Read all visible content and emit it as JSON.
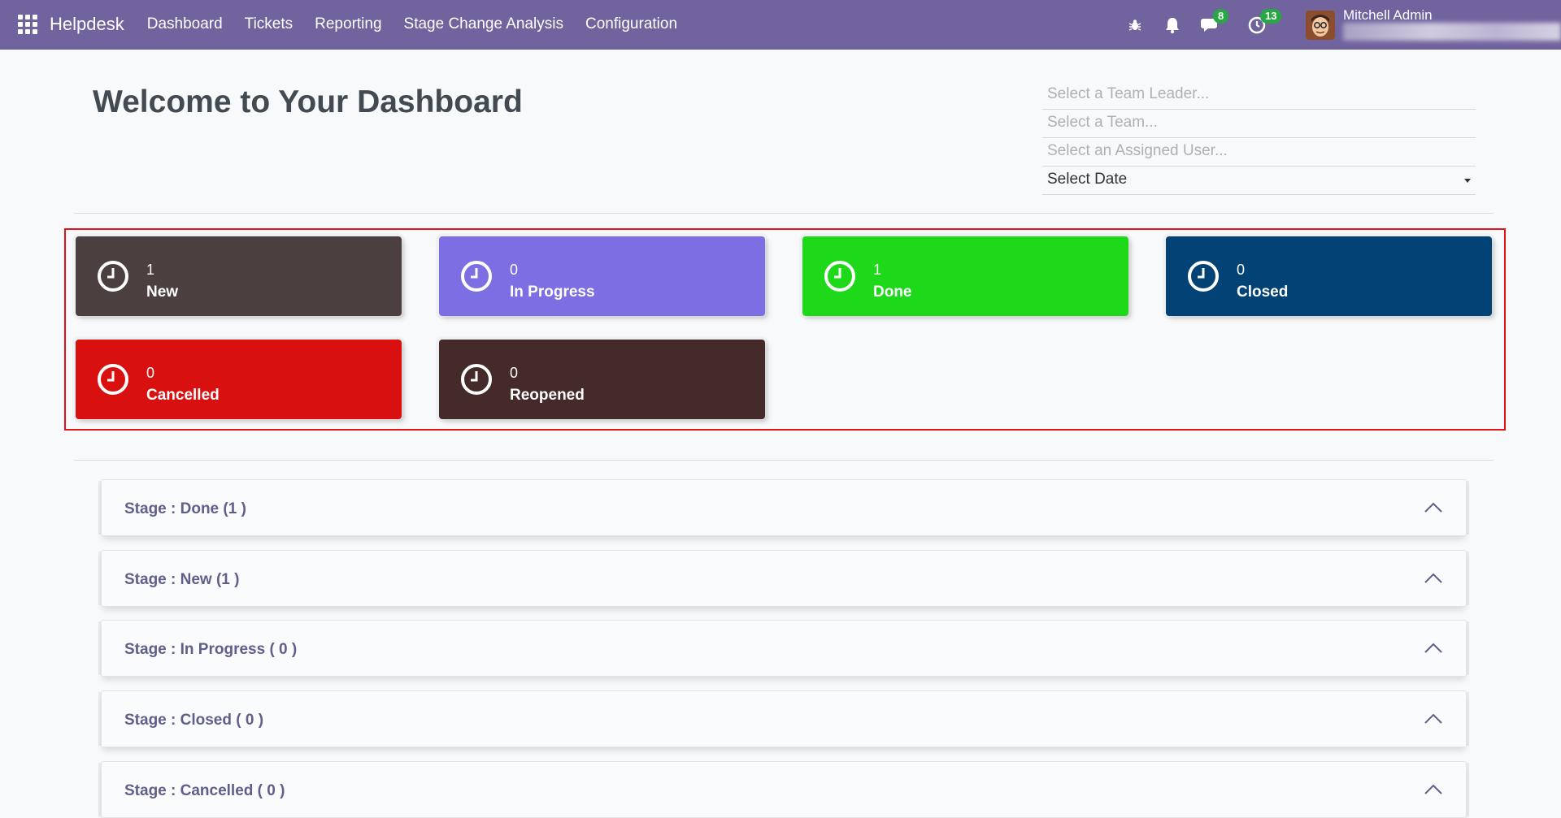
{
  "navbar": {
    "brand": "Helpdesk",
    "menu": [
      "Dashboard",
      "Tickets",
      "Reporting",
      "Stage Change Analysis",
      "Configuration"
    ],
    "icons": {
      "debug": "bug-icon",
      "notifications": "bell-icon",
      "messages": "chat-icon",
      "activities": "clock-icon"
    },
    "messages_badge": "8",
    "activities_badge": "13",
    "user_name": "Mitchell Admin"
  },
  "header": {
    "title": "Welcome to Your Dashboard"
  },
  "filters": {
    "team_leader_placeholder": "Select a Team Leader...",
    "team_placeholder": "Select a Team...",
    "assigned_user_placeholder": "Select an Assigned User...",
    "date_select": "Select Date"
  },
  "cards": [
    {
      "count": "1",
      "label": "New",
      "color": "#4c3f3f"
    },
    {
      "count": "0",
      "label": "In Progress",
      "color": "#7c6ee3"
    },
    {
      "count": "1",
      "label": "Done",
      "color": "#1ed81a"
    },
    {
      "count": "0",
      "label": "Closed",
      "color": "#034275"
    },
    {
      "count": "0",
      "label": "Cancelled",
      "color": "#d81010"
    },
    {
      "count": "0",
      "label": "Reopened",
      "color": "#452a2a"
    }
  ],
  "stages": [
    {
      "title": "Stage : Done (1 )"
    },
    {
      "title": "Stage : New (1 )"
    },
    {
      "title": "Stage : In Progress ( 0 )"
    },
    {
      "title": "Stage : Closed ( 0 )"
    },
    {
      "title": "Stage : Cancelled ( 0 )"
    }
  ],
  "colors": {
    "navbar": "#71639e",
    "highlight_frame": "#e0141b",
    "stage_title": "#5e5f8a"
  }
}
